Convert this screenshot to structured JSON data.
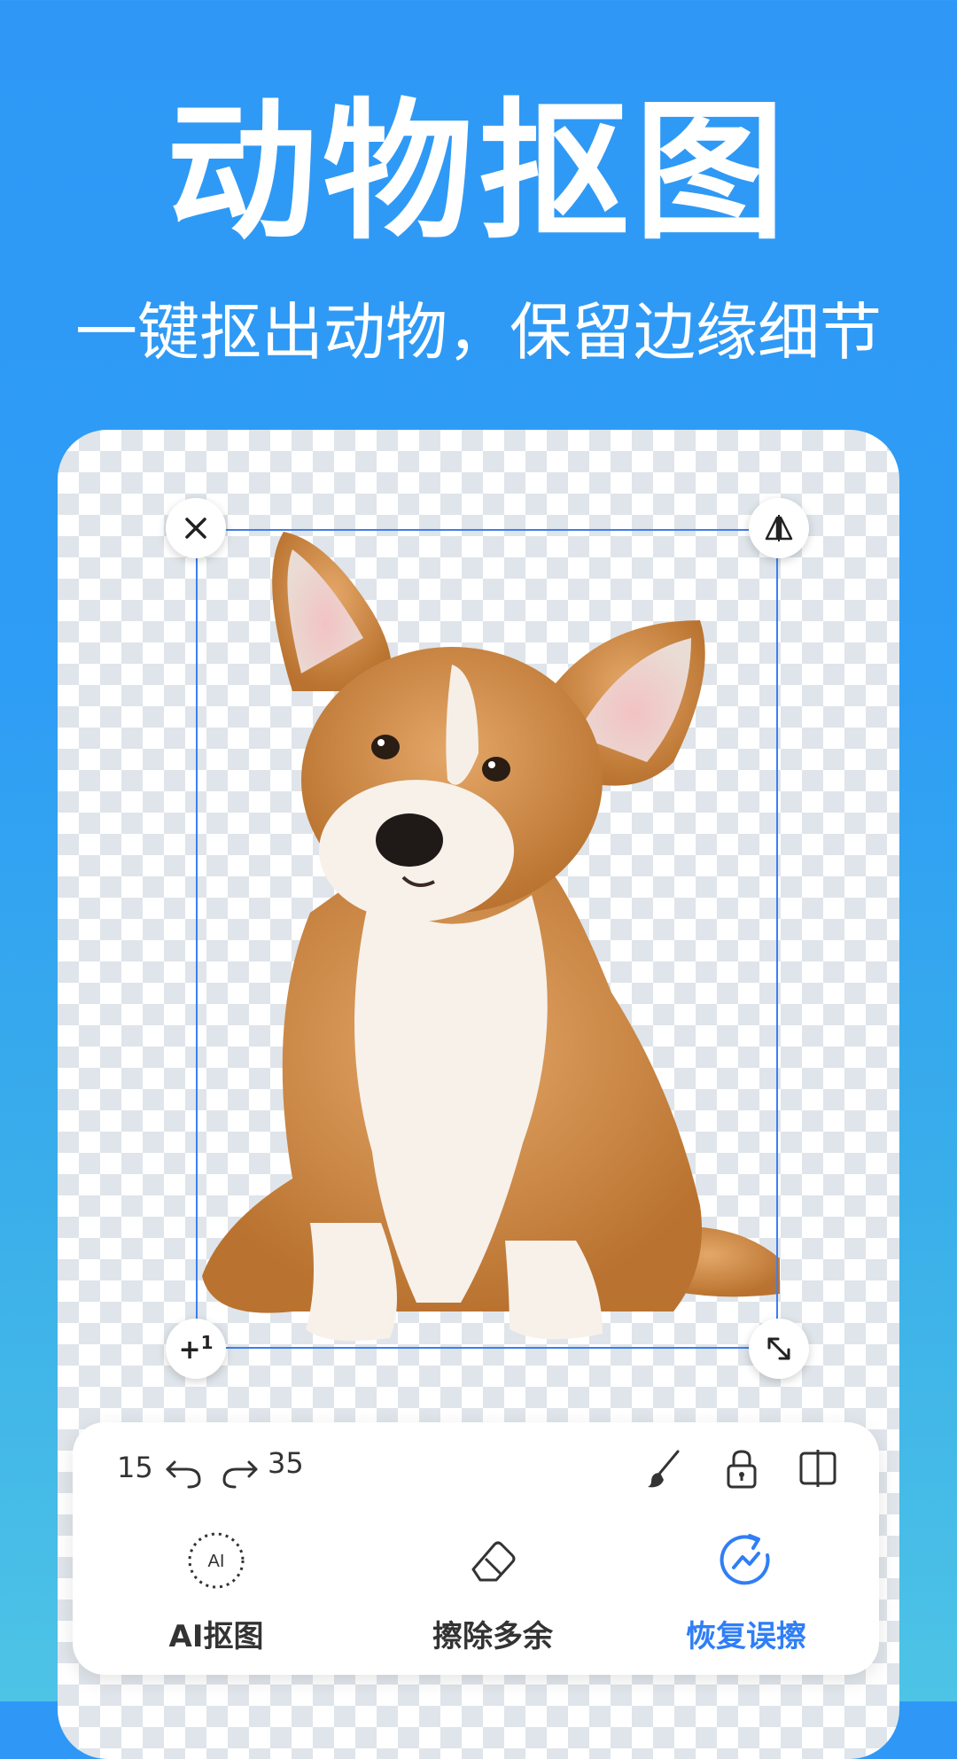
{
  "headline": "动物抠图",
  "subheadline": "一键抠出动物，保留边缘细节",
  "editor": {
    "layer_badge_sup": "1",
    "undo_count": "15",
    "redo_count": "35"
  },
  "tabs": [
    {
      "label": "AI抠图",
      "icon_text": "AI",
      "icon": "ai-cutout-icon",
      "active": false
    },
    {
      "label": "擦除多余",
      "icon": "eraser-icon",
      "active": false
    },
    {
      "label": "恢复误擦",
      "icon": "restore-icon",
      "active": true
    }
  ],
  "colors": {
    "background": "#2f98f6",
    "accent": "#2f7ef6",
    "selection_border": "#3d7ff2"
  }
}
